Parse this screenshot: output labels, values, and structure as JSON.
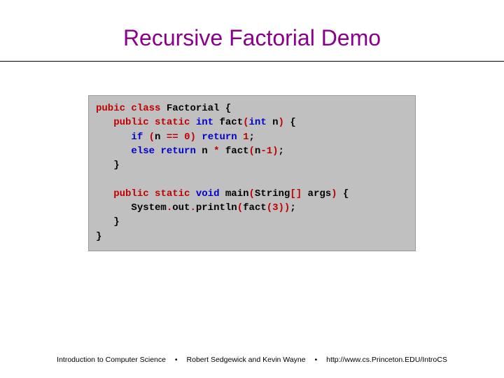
{
  "title": "Recursive Factorial Demo",
  "code": {
    "l1_pubic": "pubic",
    "l1_class": "class",
    "l1_name": "Factorial",
    "l1_brace": "{",
    "l2_public": "public",
    "l2_static": "static",
    "l2_int": "int",
    "l2_fact": "fact",
    "l2_lp": "(",
    "l2_int2": "int",
    "l2_n": "n",
    "l2_rp": ")",
    "l2_brace": "{",
    "l3_if": "if",
    "l3_lp": "(",
    "l3_n": "n",
    "l3_eq": "==",
    "l3_zero": "0",
    "l3_rp": ")",
    "l3_return": "return",
    "l3_one": "1",
    "l3_semi": ";",
    "l4_else": "else",
    "l4_return": "return",
    "l4_n": "n",
    "l4_star": "*",
    "l4_fact": "fact",
    "l4_lp": "(",
    "l4_n2": "n",
    "l4_minus": "-",
    "l4_one": "1",
    "l4_rp": ")",
    "l4_semi": ";",
    "l5_brace": "}",
    "l7_public": "public",
    "l7_static": "static",
    "l7_void": "void",
    "l7_main": "main",
    "l7_lp": "(",
    "l7_string": "String",
    "l7_br": "[]",
    "l7_args": "args",
    "l7_rp": ")",
    "l7_brace": "{",
    "l8_system": "System",
    "l8_d1": ".",
    "l8_out": "out",
    "l8_d2": ".",
    "l8_println": "println",
    "l8_lp": "(",
    "l8_fact": "fact",
    "l8_lp2": "(",
    "l8_three": "3",
    "l8_rp2": ")",
    "l8_rp": ")",
    "l8_semi": ";",
    "l9_brace": "}",
    "l10_brace": "}"
  },
  "footer": {
    "course": "Introduction to Computer Science",
    "bullet": "•",
    "authors": "Robert Sedgewick and Kevin Wayne",
    "url": "http://www.cs.Princeton.EDU/IntroCS"
  }
}
